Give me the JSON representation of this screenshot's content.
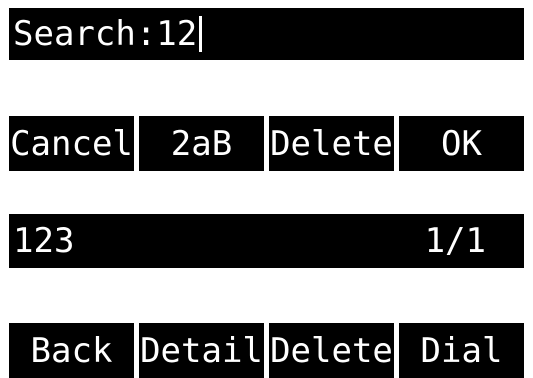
{
  "search": {
    "label": "Search:",
    "value": "12"
  },
  "input_softkeys": {
    "cancel": "Cancel",
    "input_mode": "2aB",
    "delete": "Delete",
    "ok": "OK"
  },
  "result": {
    "name": "123",
    "page_indicator": "1/1"
  },
  "result_softkeys": {
    "back": "Back",
    "detail": "Detail",
    "delete": "Delete",
    "dial": "Dial"
  }
}
